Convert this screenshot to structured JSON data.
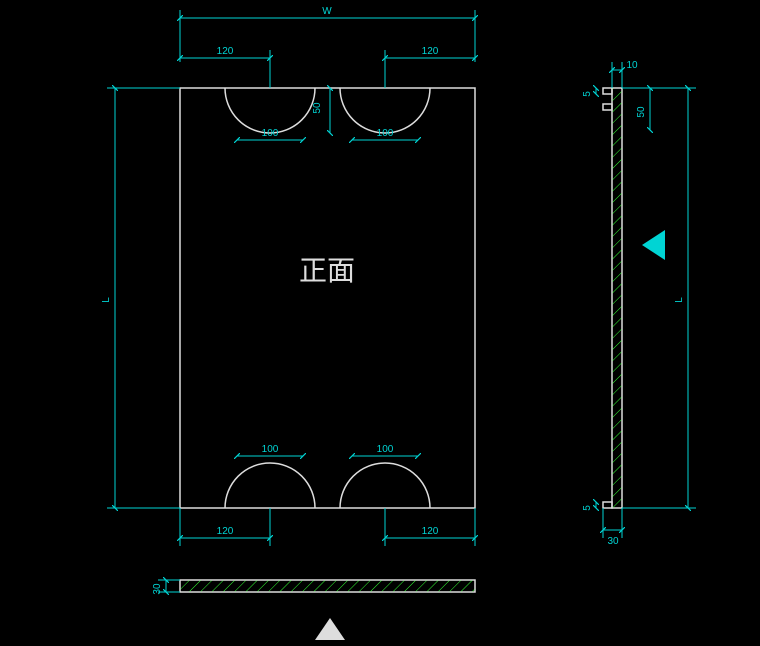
{
  "dims": {
    "W": "W",
    "L": "L",
    "L2": "L",
    "d120_tl": "120",
    "d120_tr": "120",
    "d120_bl": "120",
    "d120_br": "120",
    "d100_tl": "100",
    "d100_tr": "100",
    "d100_bl": "100",
    "d100_br": "100",
    "d50": "50",
    "d30_a": "30",
    "d30_b": "30",
    "d10": "10",
    "d5_a": "5",
    "d5_b": "5",
    "d50_r": "50"
  },
  "label": "正面"
}
